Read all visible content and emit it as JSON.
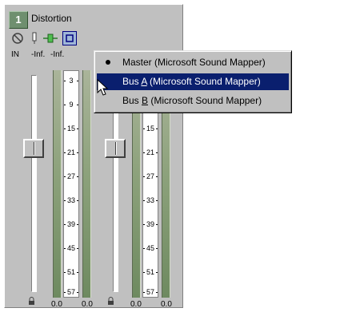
{
  "strip": {
    "number": "1",
    "title": "Distortion",
    "toolbar": [
      "bypass-icon",
      "insert-icon",
      "route-icon",
      "output-icon"
    ],
    "labels": {
      "in": "IN",
      "inf_left": "-Inf.",
      "inf_right": "-Inf."
    },
    "scale_ticks": [
      "3",
      "9",
      "15",
      "21",
      "27",
      "33",
      "39",
      "45",
      "51",
      "57"
    ],
    "readouts": [
      "0.0",
      "0.0",
      "0.0",
      "0.0"
    ]
  },
  "context_menu": {
    "items": [
      {
        "label": "Master (Microsoft Sound Mapper)",
        "checked": true,
        "highlighted": false
      },
      {
        "pre": "Bus ",
        "key": "A",
        "post": "  (Microsoft Sound Mapper)",
        "checked": false,
        "highlighted": true
      },
      {
        "pre": "Bus ",
        "key": "B",
        "post": "  (Microsoft Sound Mapper)",
        "checked": false,
        "highlighted": false
      }
    ]
  },
  "colors": {
    "panel": "#c0c0c0",
    "badge": "#6f8f6f",
    "highlight": "#0a1f6e",
    "meter": "#8da27c"
  }
}
